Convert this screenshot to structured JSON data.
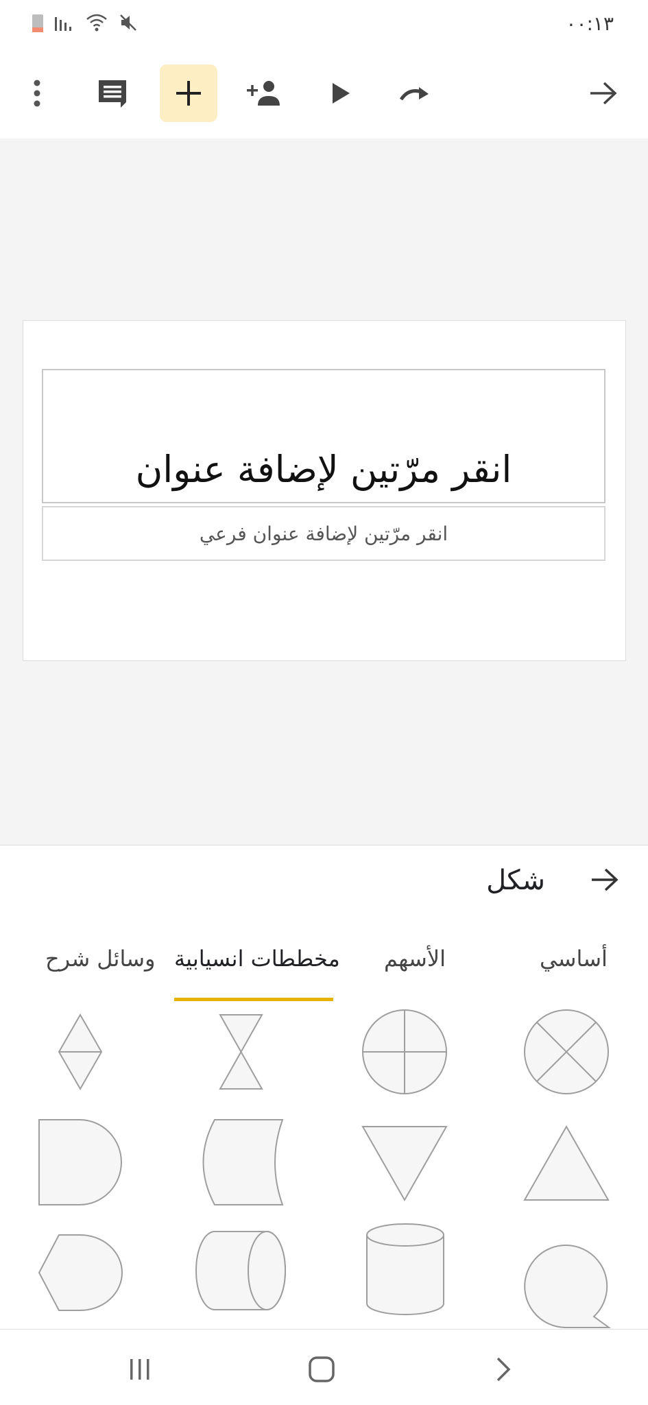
{
  "status": {
    "time": "۰۰:۱۳"
  },
  "toolbar": {
    "icons": [
      "more-vert-icon",
      "comment-icon",
      "add-icon",
      "add-person-icon",
      "play-icon",
      "redo-icon",
      "back-arrow-icon"
    ]
  },
  "slide": {
    "title_placeholder": "انقر مرّتين لإضافة عنوان",
    "subtitle_placeholder": "انقر مرّتين لإضافة عنوان فرعي"
  },
  "panel": {
    "title": "شكل",
    "tabs": {
      "basic": "أساسي",
      "arrows": "الأسهم",
      "flowchart": "مخططات انسيابية",
      "callouts": "وسائل شرح"
    },
    "selected_tab": "flowchart",
    "shapes": [
      "summing-junction",
      "or",
      "hourglass",
      "sort",
      "extract",
      "merge",
      "manual-input-curve",
      "delay",
      "sequential-access-storage",
      "magnetic-disk",
      "direct-access-storage",
      "display"
    ]
  },
  "colors": {
    "accent": "#e6b400",
    "active_button_bg": "#fdefc3",
    "canvas_bg": "#f4f4f4",
    "shape_fill": "#f6f6f6",
    "shape_stroke": "#9e9e9e"
  },
  "navigation": {
    "icons": [
      "recent-apps-icon",
      "home-icon",
      "back-icon"
    ]
  }
}
